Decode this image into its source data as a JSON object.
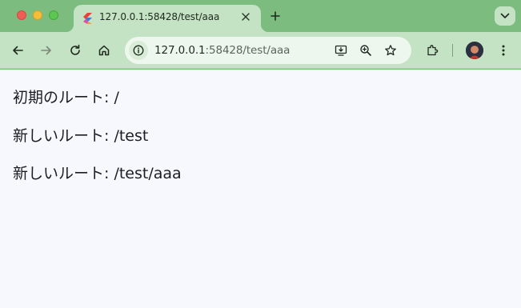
{
  "browser": {
    "tab": {
      "title": "127.0.0.1:58428/test/aaa",
      "favicon": "flutter-icon"
    },
    "address_bar": {
      "host": "127.0.0.1",
      "rest": ":58428/test/aaa"
    },
    "colors": {
      "frame": "#7cbd7f",
      "toolbar": "#c4e2c4",
      "omnibox": "#eef7ee",
      "page_background": "#f7f8fe"
    }
  },
  "page": {
    "lines": [
      "初期のルート: /",
      "新しいルート: /test",
      "新しいルート: /test/aaa"
    ]
  }
}
